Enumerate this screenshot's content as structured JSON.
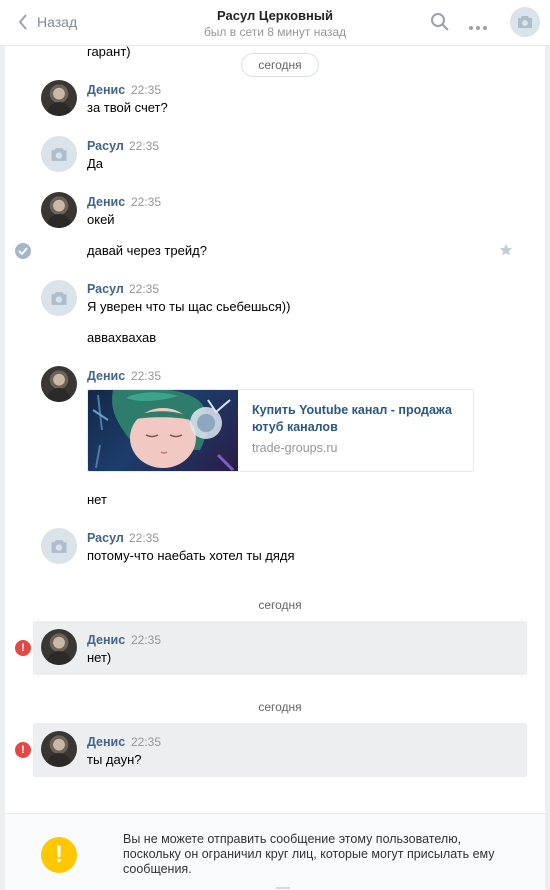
{
  "header": {
    "back_label": "Назад",
    "title": "Расул Церковный",
    "status": "был в сети 8 минут назад"
  },
  "top_clip": "гарант)",
  "dates": [
    "сегодня",
    "сегодня",
    "сегодня"
  ],
  "messages": [
    {
      "author": "Денис",
      "time": "22:35",
      "lines": [
        "за твой счет?"
      ]
    },
    {
      "author": "Расул",
      "time": "22:35",
      "lines": [
        "Да"
      ]
    },
    {
      "author": "Денис",
      "time": "22:35",
      "lines": [
        "окей",
        "давай через трейд?"
      ]
    },
    {
      "author": "Расул",
      "time": "22:35",
      "lines": [
        "Я уверен что ты щас сьебешься))",
        "аввахвахав"
      ]
    },
    {
      "author": "Денис",
      "time": "22:35",
      "lines": [
        "нет"
      ]
    },
    {
      "author": "Расул",
      "time": "22:35",
      "lines": [
        "потому-что наебать хотел ты дядя"
      ]
    },
    {
      "author": "Денис",
      "time": "22:35",
      "lines": [
        "нет)"
      ]
    },
    {
      "author": "Денис",
      "time": "22:35",
      "lines": [
        "ты даун?"
      ]
    }
  ],
  "link_card": {
    "title": "Купить Youtube канал - продажа ютуб каналов",
    "domain": "trade-groups.ru"
  },
  "footer": {
    "notice": "Вы не можете отправить сообщение этому пользователю, поскольку он ограничил круг лиц, которые могут присылать ему сообщения."
  },
  "colors": {
    "link": "#42648b",
    "error": "#e64646",
    "warning": "#ffc700",
    "highlight": "#edeef0"
  },
  "icons": [
    "back-arrow-icon",
    "search-icon",
    "more-icon",
    "camera-icon",
    "check-icon",
    "star-icon",
    "error-icon",
    "warning-icon"
  ]
}
